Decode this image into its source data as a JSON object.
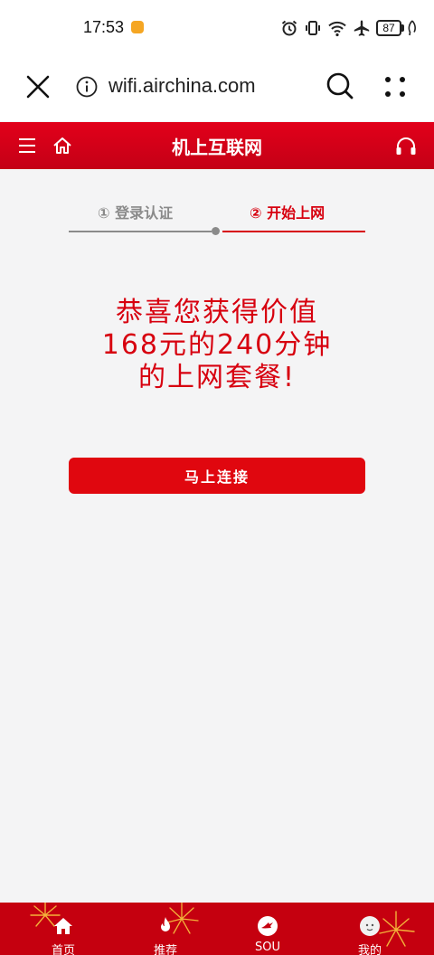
{
  "status_bar": {
    "time": "17:53",
    "battery": "87"
  },
  "browser": {
    "url": "wifi.airchina.com"
  },
  "header": {
    "title": "机上互联网"
  },
  "steps": {
    "step1_label": "① 登录认证",
    "step2_label": "② 开始上网"
  },
  "congrats": {
    "line1": "恭喜您获得价值",
    "line2": "168元的240分钟",
    "line3": "的上网套餐!"
  },
  "connect_button": {
    "label": "马上连接"
  },
  "bottom_nav": {
    "items": [
      {
        "label": "首页",
        "icon": "home-icon"
      },
      {
        "label": "推荐",
        "icon": "flame-icon"
      },
      {
        "label": "SOU",
        "icon": "sou-icon"
      },
      {
        "label": "我的",
        "icon": "avatar-icon"
      }
    ]
  },
  "colors": {
    "brand_red": "#e2001a",
    "button_red": "#e0070f",
    "nav_red": "#c5000f",
    "step_gray": "#8a8a8a",
    "page_bg": "#f4f4f5"
  }
}
